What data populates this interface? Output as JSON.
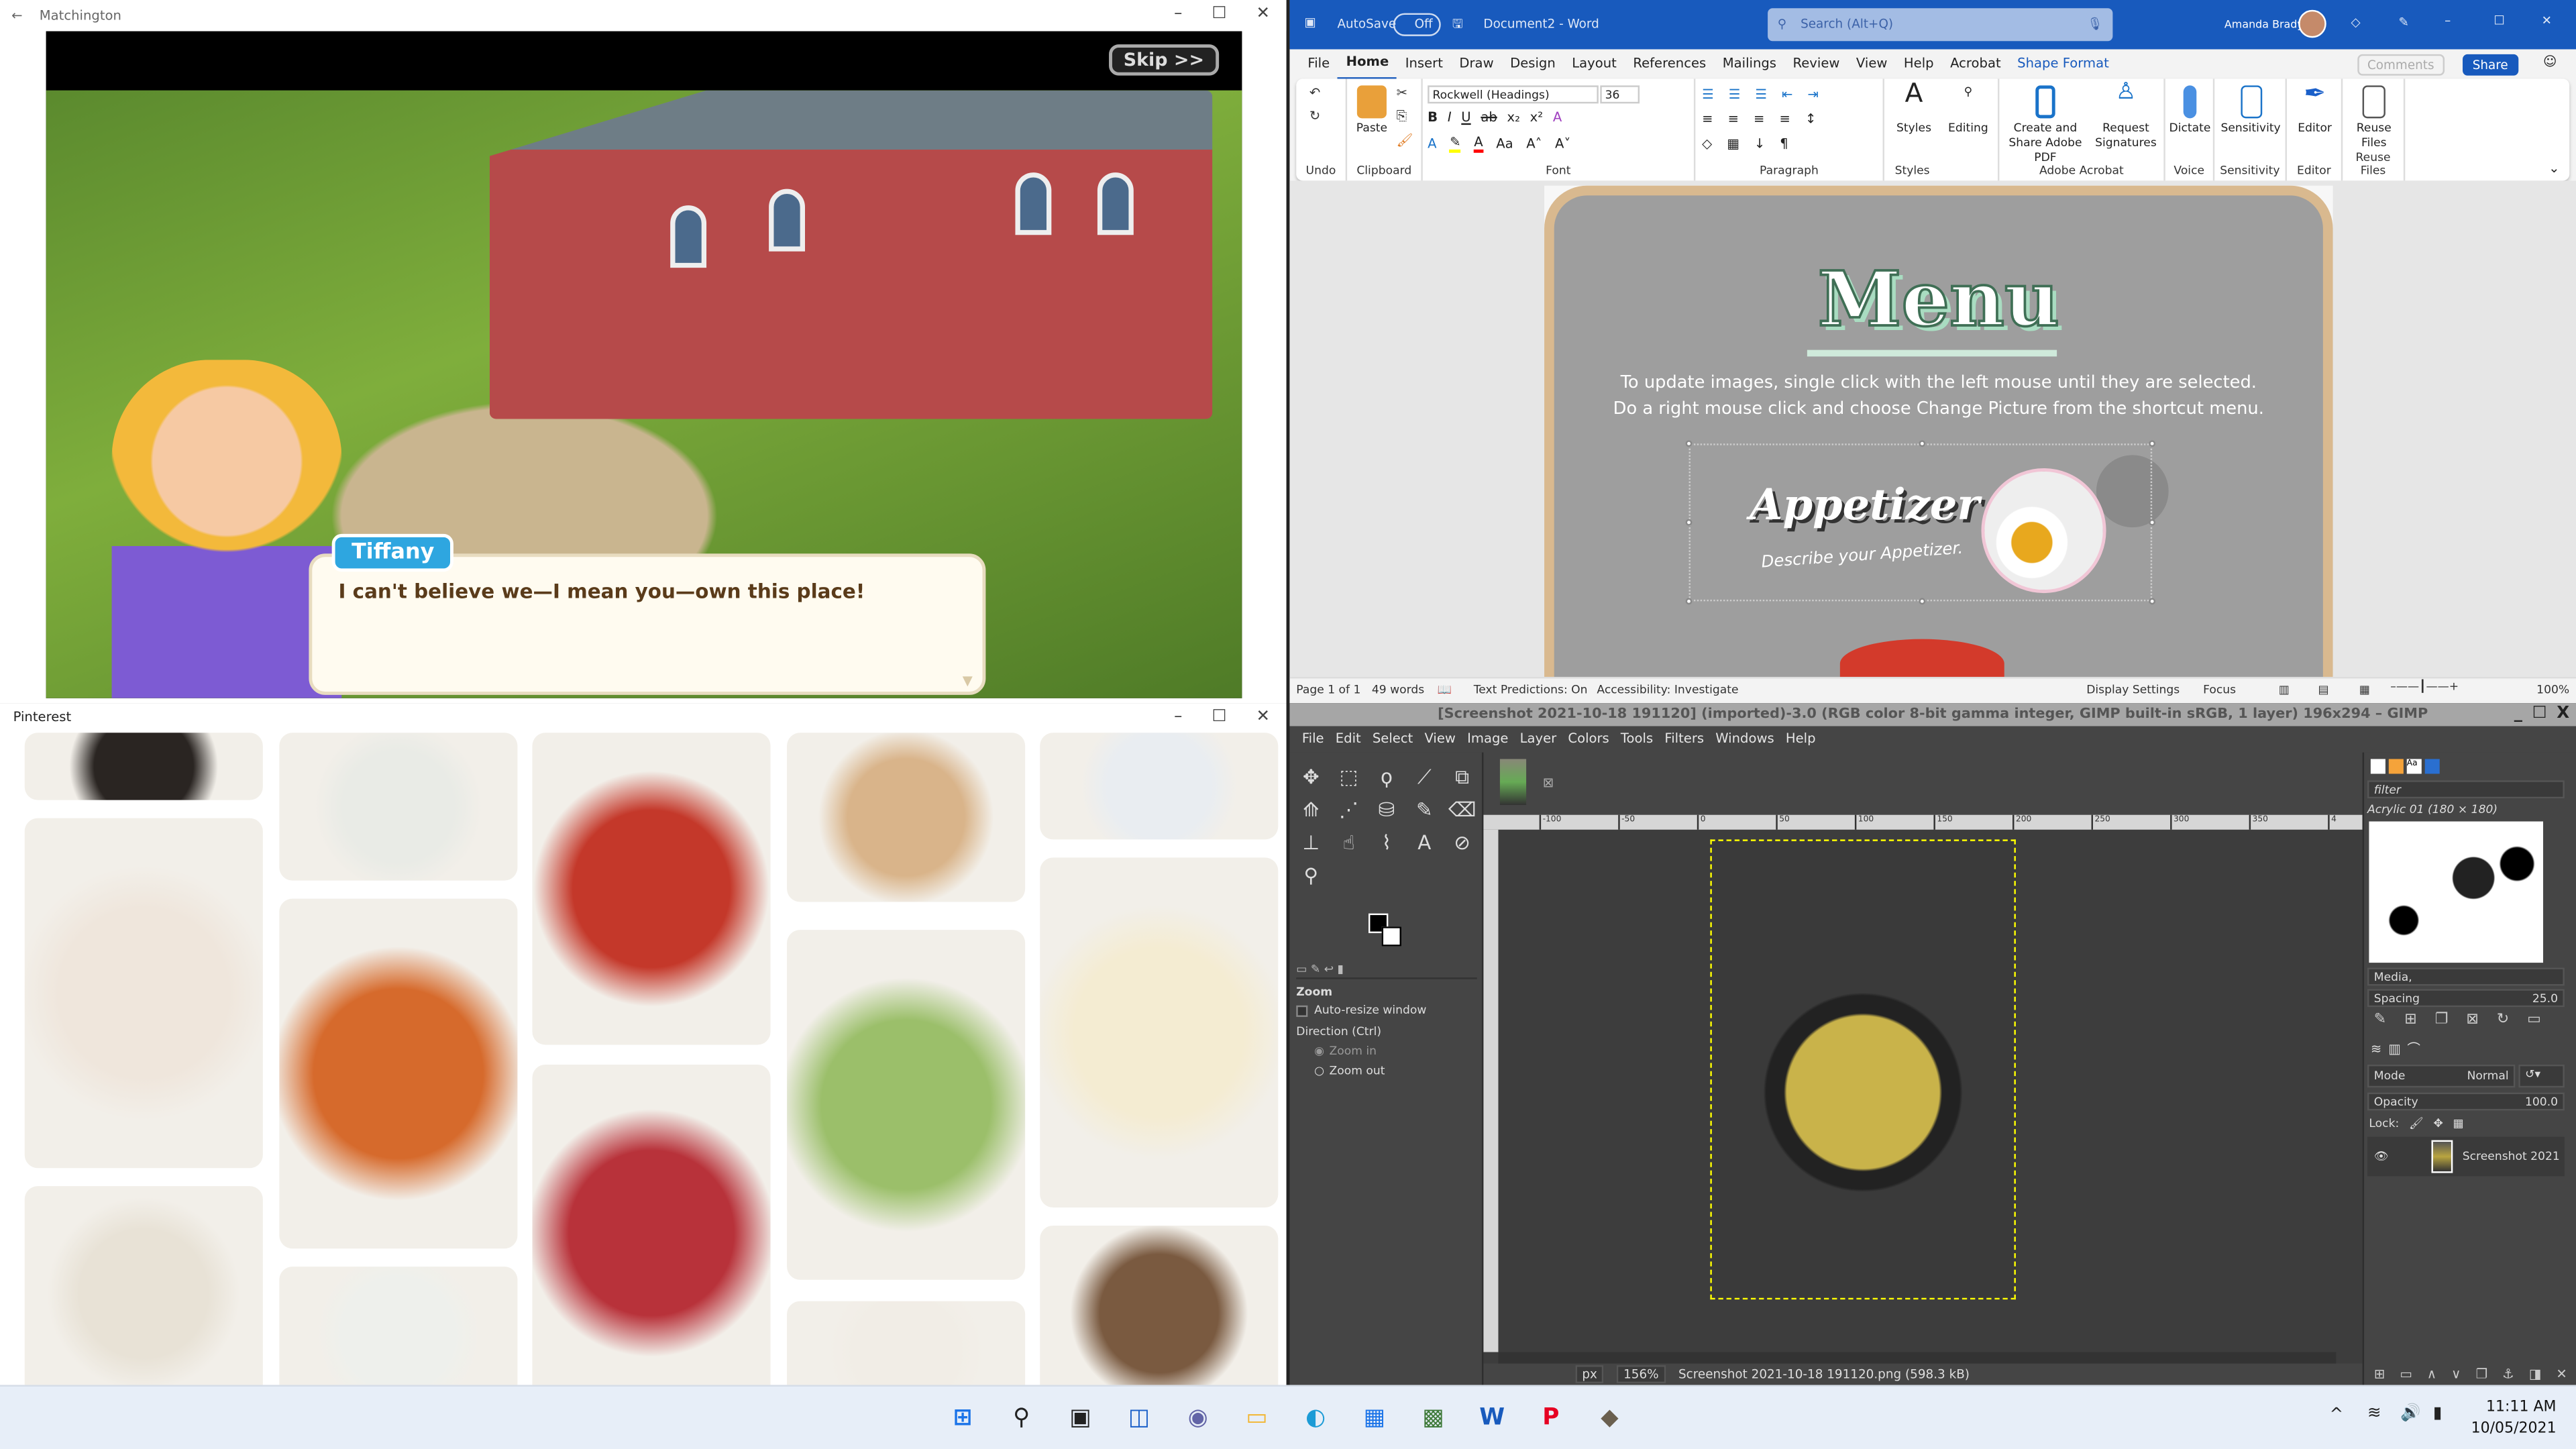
{
  "game": {
    "title": "Matchington",
    "skip": "Skip >>",
    "speaker": "Tiffany",
    "dialog": "I can't believe we—I mean you—own this place!"
  },
  "pinterest": {
    "title": "Pinterest",
    "tile_colors": [
      [
        "#2a2522",
        "#efe6dc",
        "#e8e2d6"
      ],
      [
        "#e9ebe6",
        "#d66a2c",
        "#eef0ec"
      ],
      [
        "#c4382a",
        "#b8323a"
      ],
      [
        "#d9b48a",
        "#9bbf6a",
        "#f1ede6"
      ],
      [
        "#e9edf1",
        "#f4ecd2",
        "#7a5a40"
      ]
    ]
  },
  "word": {
    "autosave": "AutoSave",
    "autosave_state": "Off",
    "doc_title": "Document2 - Word",
    "search_placeholder": "Search (Alt+Q)",
    "user": "Amanda Brady",
    "tabs": [
      "File",
      "Home",
      "Insert",
      "Draw",
      "Design",
      "Layout",
      "References",
      "Mailings",
      "Review",
      "View",
      "Help",
      "Acrobat",
      "Shape Format"
    ],
    "active_tab": "Home",
    "comments": "Comments",
    "share": "Share",
    "font_name": "Rockwell (Headings)",
    "font_size": "36",
    "groups": [
      "Undo",
      "Clipboard",
      "Font",
      "Paragraph",
      "Styles",
      "Adobe Acrobat",
      "Voice",
      "Sensitivity",
      "Editor",
      "Reuse Files"
    ],
    "buttons": {
      "paste": "Paste",
      "styles": "Styles",
      "editing": "Editing",
      "create_pdf": "Create and Share Adobe PDF",
      "request_sig": "Request Signatures",
      "dictate": "Dictate",
      "sensitivity": "Sensitivity",
      "editor": "Editor",
      "reuse": "Reuse Files"
    },
    "doc": {
      "heading": "Menu",
      "instructions": "To update images, single click with the left mouse until they are selected.  Do a right mouse click and choose Change Picture from the shortcut menu.",
      "section": "Appetizer",
      "section_desc": "Describe your Appetizer."
    },
    "status": {
      "page": "Page 1 of 1",
      "words": "49 words",
      "predictions": "Text Predictions: On",
      "accessibility": "Accessibility: Investigate",
      "display": "Display Settings",
      "focus": "Focus",
      "zoom": "100%"
    },
    "accent": "#185abd"
  },
  "gimp": {
    "title": "[Screenshot 2021-10-18 191120] (imported)-3.0 (RGB color 8-bit gamma integer, GIMP built-in sRGB, 1 layer) 196x294 – GIMP",
    "menu": [
      "File",
      "Edit",
      "Select",
      "View",
      "Image",
      "Layer",
      "Colors",
      "Tools",
      "Filters",
      "Windows",
      "Help"
    ],
    "tool_options": {
      "title": "Zoom",
      "auto_resize": "Auto-resize window",
      "direction": "Direction  (Ctrl)",
      "zoom_in": "Zoom in",
      "zoom_out": "Zoom out",
      "selected": "Zoom in"
    },
    "ruler_ticks": [
      "-100",
      "-50",
      "0",
      "50",
      "100",
      "150",
      "200",
      "250",
      "300",
      "350",
      "4"
    ],
    "brushes": {
      "filter": "filter",
      "brush_name": "Acrylic 01 (180 × 180)",
      "tag": "Media,",
      "spacing_label": "Spacing",
      "spacing": "25.0"
    },
    "layers": {
      "mode_label": "Mode",
      "mode": "Normal",
      "opacity_label": "Opacity",
      "opacity": "100.0",
      "lock": "Lock:",
      "layer_name": "Screenshot 2021"
    },
    "status": {
      "unit": "px",
      "zoom": "156%",
      "file": "Screenshot 2021-10-18 191120.png (598.3 kB)"
    }
  },
  "taskbar": {
    "apps": [
      "start",
      "search",
      "task-view",
      "widgets",
      "teams-chat",
      "file-explorer",
      "edge",
      "store",
      "matchington",
      "word",
      "pinterest",
      "gimp"
    ],
    "time": "11:11 AM",
    "date": "10/05/2021"
  }
}
